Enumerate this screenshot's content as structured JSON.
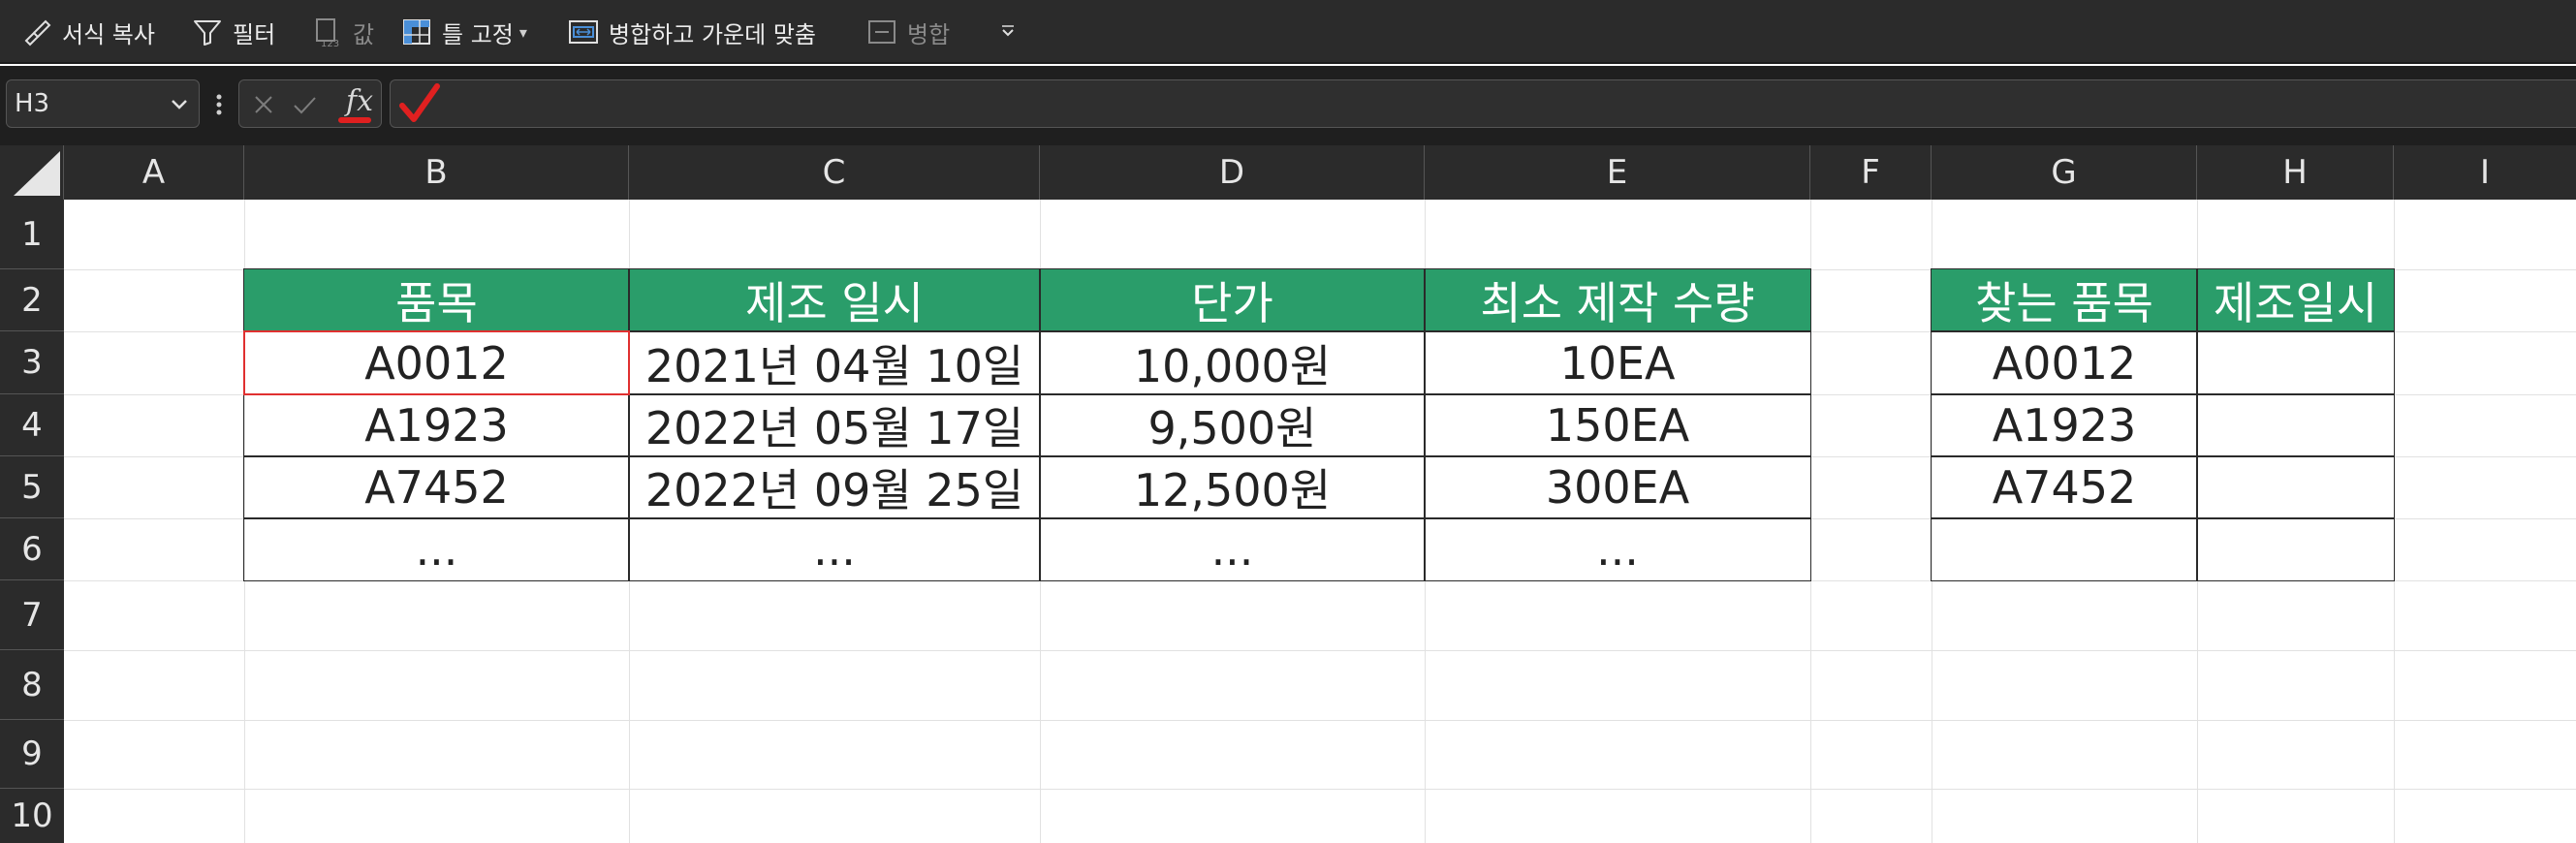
{
  "ribbon": {
    "format_painter": "서식 복사",
    "filter": "필터",
    "values": "값",
    "freeze": "틀 고정",
    "merge_center": "병합하고 가운데 맞춤",
    "merge": "병합"
  },
  "formula_bar": {
    "name_box": "H3",
    "fx": "fx",
    "value": ""
  },
  "columns": [
    "A",
    "B",
    "C",
    "D",
    "E",
    "F",
    "G",
    "H",
    "I"
  ],
  "rows": [
    "1",
    "2",
    "3",
    "4",
    "5",
    "6",
    "7",
    "8",
    "9",
    "10"
  ],
  "table1": {
    "headers": [
      "품목",
      "제조 일시",
      "단가",
      "최소 제작 수량"
    ],
    "rows": [
      [
        "A0012",
        "2021년 04월 10일",
        "10,000원",
        "10EA"
      ],
      [
        "A1923",
        "2022년 05월 17일",
        "9,500원",
        "150EA"
      ],
      [
        "A7452",
        "2022년 09월 25일",
        "12,500원",
        "300EA"
      ],
      [
        "...",
        "...",
        "...",
        "..."
      ]
    ]
  },
  "table2": {
    "headers": [
      "찾는 품목",
      "제조일시"
    ],
    "rows": [
      [
        "A0012",
        ""
      ],
      [
        "A1923",
        ""
      ],
      [
        "A7452",
        ""
      ],
      [
        "",
        ""
      ]
    ]
  },
  "colors": {
    "header_fill": "#2a9d6a",
    "selection": "#e03030",
    "annotation_check": "#e02020"
  },
  "active_cell": "H3"
}
